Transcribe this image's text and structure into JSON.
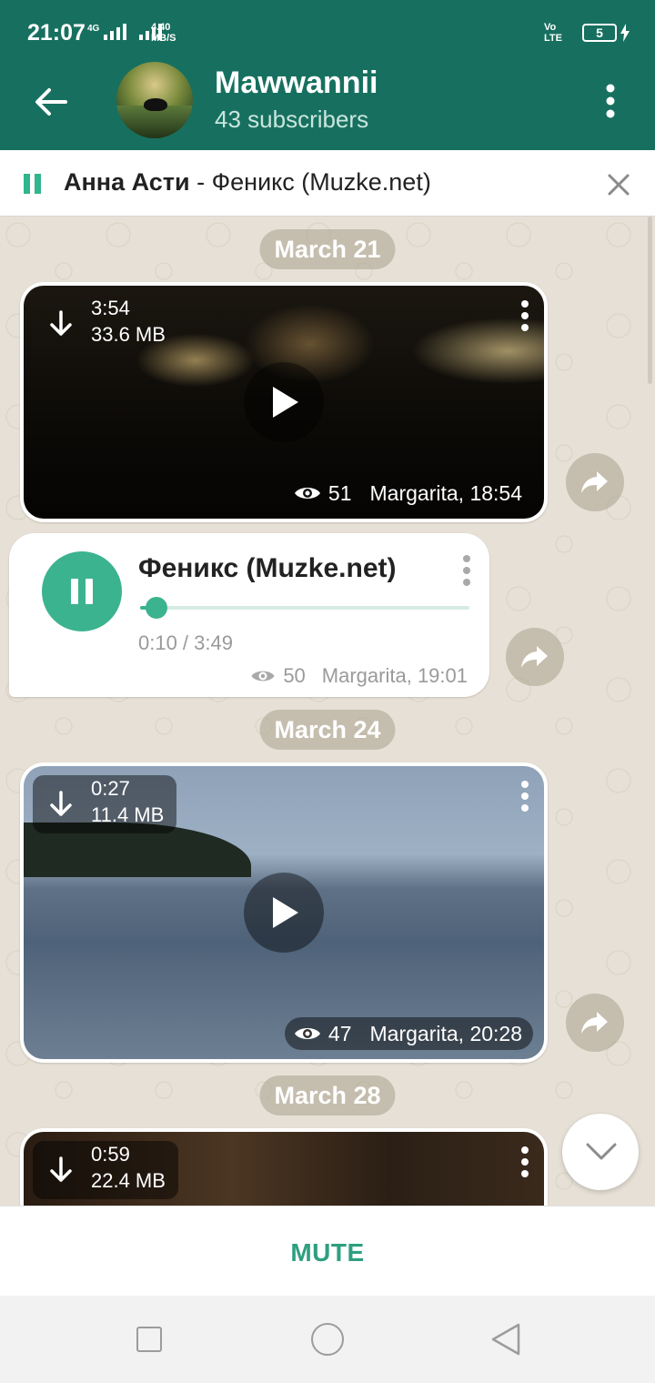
{
  "status_bar": {
    "time": "21:07",
    "network_type": "4G",
    "speed_value": "4.40",
    "speed_unit": "MB/S",
    "volte_top": "Vo",
    "volte_bottom": "LTE",
    "battery": "5"
  },
  "header": {
    "title": "Mawwannii",
    "subtitle": "43 subscribers"
  },
  "now_playing": {
    "artist": "Анна Асти",
    "separator": " - ",
    "track": "Феникс (Muzke.net)"
  },
  "messages": [
    {
      "date": "March 21",
      "type": "video",
      "duration": "3:54",
      "size": "33.6 MB",
      "views": "51",
      "meta": "Margarita, 18:54"
    },
    {
      "type": "audio",
      "title": "Феникс (Muzke.net)",
      "time": "0:10 / 3:49",
      "progress": 0.05,
      "views": "50",
      "meta": "Margarita, 19:01"
    },
    {
      "date": "March 24",
      "type": "video",
      "duration": "0:27",
      "size": "11.4 MB",
      "views": "47",
      "meta": "Margarita, 20:28"
    },
    {
      "date": "March 28",
      "type": "video",
      "duration": "0:59",
      "size": "22.4 MB"
    }
  ],
  "bottom": {
    "mute_label": "MUTE"
  },
  "colors": {
    "header": "#17705f",
    "accent": "#3cb38f",
    "mute_text": "#2e9f7f"
  },
  "icons": [
    "back-arrow-icon",
    "more-vert-icon",
    "pause-icon",
    "close-icon",
    "download-icon",
    "play-icon",
    "eye-icon",
    "share-icon",
    "chevron-down-icon"
  ]
}
